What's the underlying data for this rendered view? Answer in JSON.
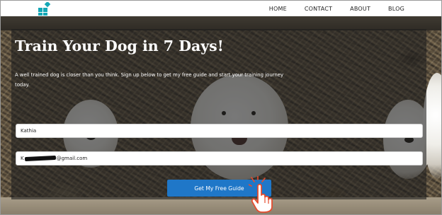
{
  "nav": {
    "logo_icon": "blue-blocks-logo-icon",
    "items": [
      "HOME",
      "CONTACT",
      "ABOUT",
      "BLOG"
    ]
  },
  "hero": {
    "headline": "Train Your Dog in 7 Days!",
    "subtext": "A well trained dog is closer than you think. Sign up below to get my free guide and start your training journey today."
  },
  "form": {
    "name_value": "Kathia",
    "email_prefix": "K",
    "email_suffix": "@gmail.com",
    "submit_label": "Get My Free Guide"
  },
  "colors": {
    "accent": "#1f77c8",
    "logo": "#13a7b6"
  },
  "cursor_icon": "pointer-hand-cursor-icon"
}
